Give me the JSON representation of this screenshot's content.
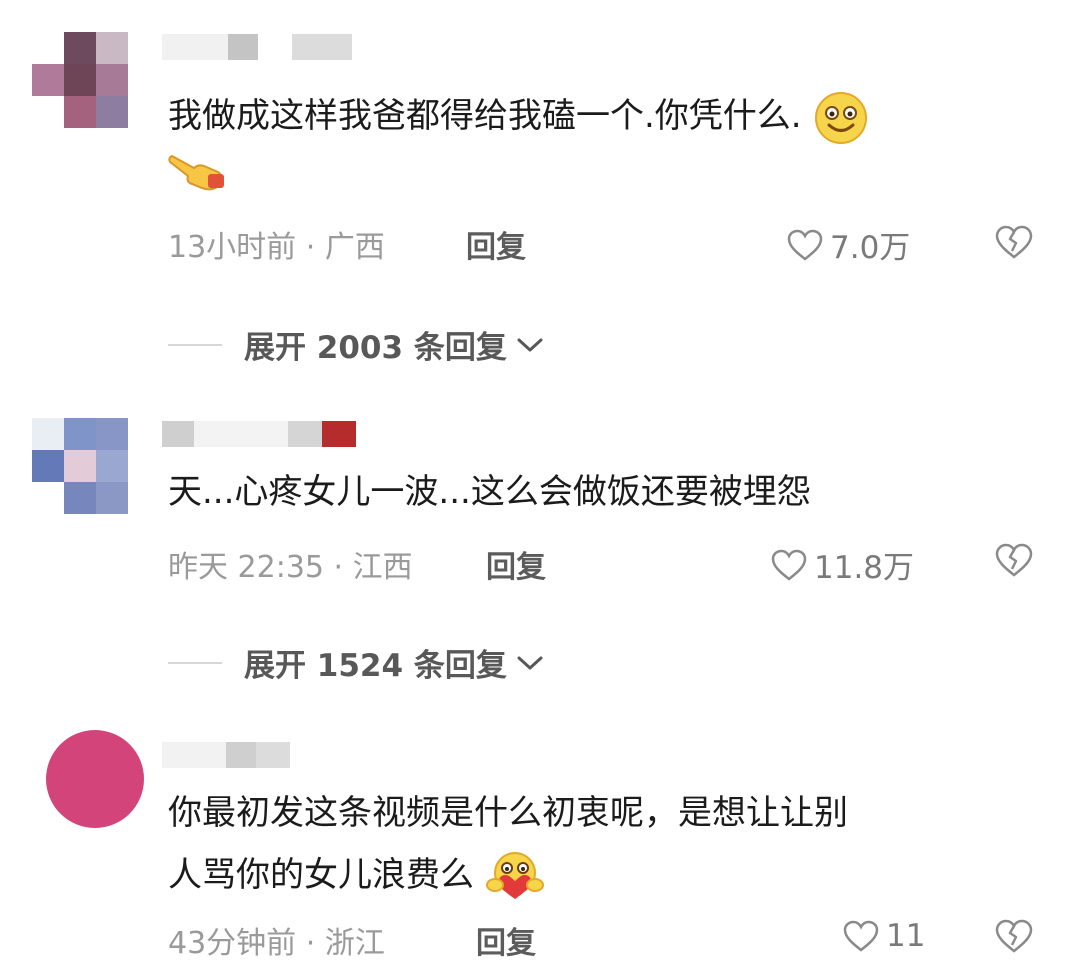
{
  "comments": [
    {
      "text_line1": "我做成这样我爸都得给我磕一个.你凭什么.",
      "text_line2": "",
      "time": "13小时前",
      "region": "广西",
      "reply_label": "回复",
      "likes": "7.0万",
      "expand_label": "展开 2003 条回复"
    },
    {
      "text_line1": "天...心疼女儿一波...这么会做饭还要被埋怨",
      "text_line2": "",
      "time": "昨天 22:35",
      "region": "江西",
      "reply_label": "回复",
      "likes": "11.8万",
      "expand_label": "展开 1524 条回复"
    },
    {
      "text_line1": "你最初发这条视频是什么初衷呢，是想让让别",
      "text_line2": "人骂你的女儿浪费么",
      "time": "43分钟前",
      "region": "浙江",
      "reply_label": "回复",
      "likes": "11"
    }
  ],
  "separator": "·",
  "colors": {
    "text": "#1b1b1b",
    "meta": "#9a9a9a",
    "avatar3": "#d3447a"
  },
  "icons": [
    "heart-outline-icon",
    "broken-heart-icon",
    "chevron-down-icon",
    "smiling-emoji-icon",
    "pointing-hand-emoji-icon",
    "heart-hug-emoji-icon"
  ]
}
